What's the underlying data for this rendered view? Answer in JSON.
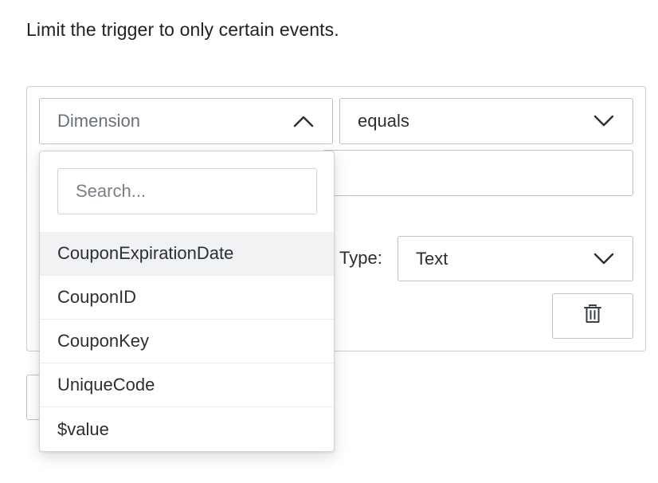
{
  "description": "Limit the trigger to only certain events.",
  "filter": {
    "dimension_placeholder": "Dimension",
    "operator_value": "equals",
    "value_input": "",
    "type_label": "Type:",
    "type_value": "Text"
  },
  "dropdown": {
    "search_placeholder": "Search...",
    "highlighted_index": 0,
    "options": [
      {
        "label": "CouponExpirationDate"
      },
      {
        "label": "CouponID"
      },
      {
        "label": "CouponKey"
      },
      {
        "label": "UniqueCode"
      },
      {
        "label": "$value"
      }
    ]
  },
  "icons": {
    "dimension_chevron": "chevron-up-icon",
    "operator_chevron": "chevron-down-icon",
    "type_chevron": "chevron-down-icon",
    "delete": "trash-icon"
  },
  "colors": {
    "border": "#bcc1c6",
    "highlight": "#f1f2f4",
    "text": "#2b2f33",
    "placeholder": "#6b7178"
  }
}
